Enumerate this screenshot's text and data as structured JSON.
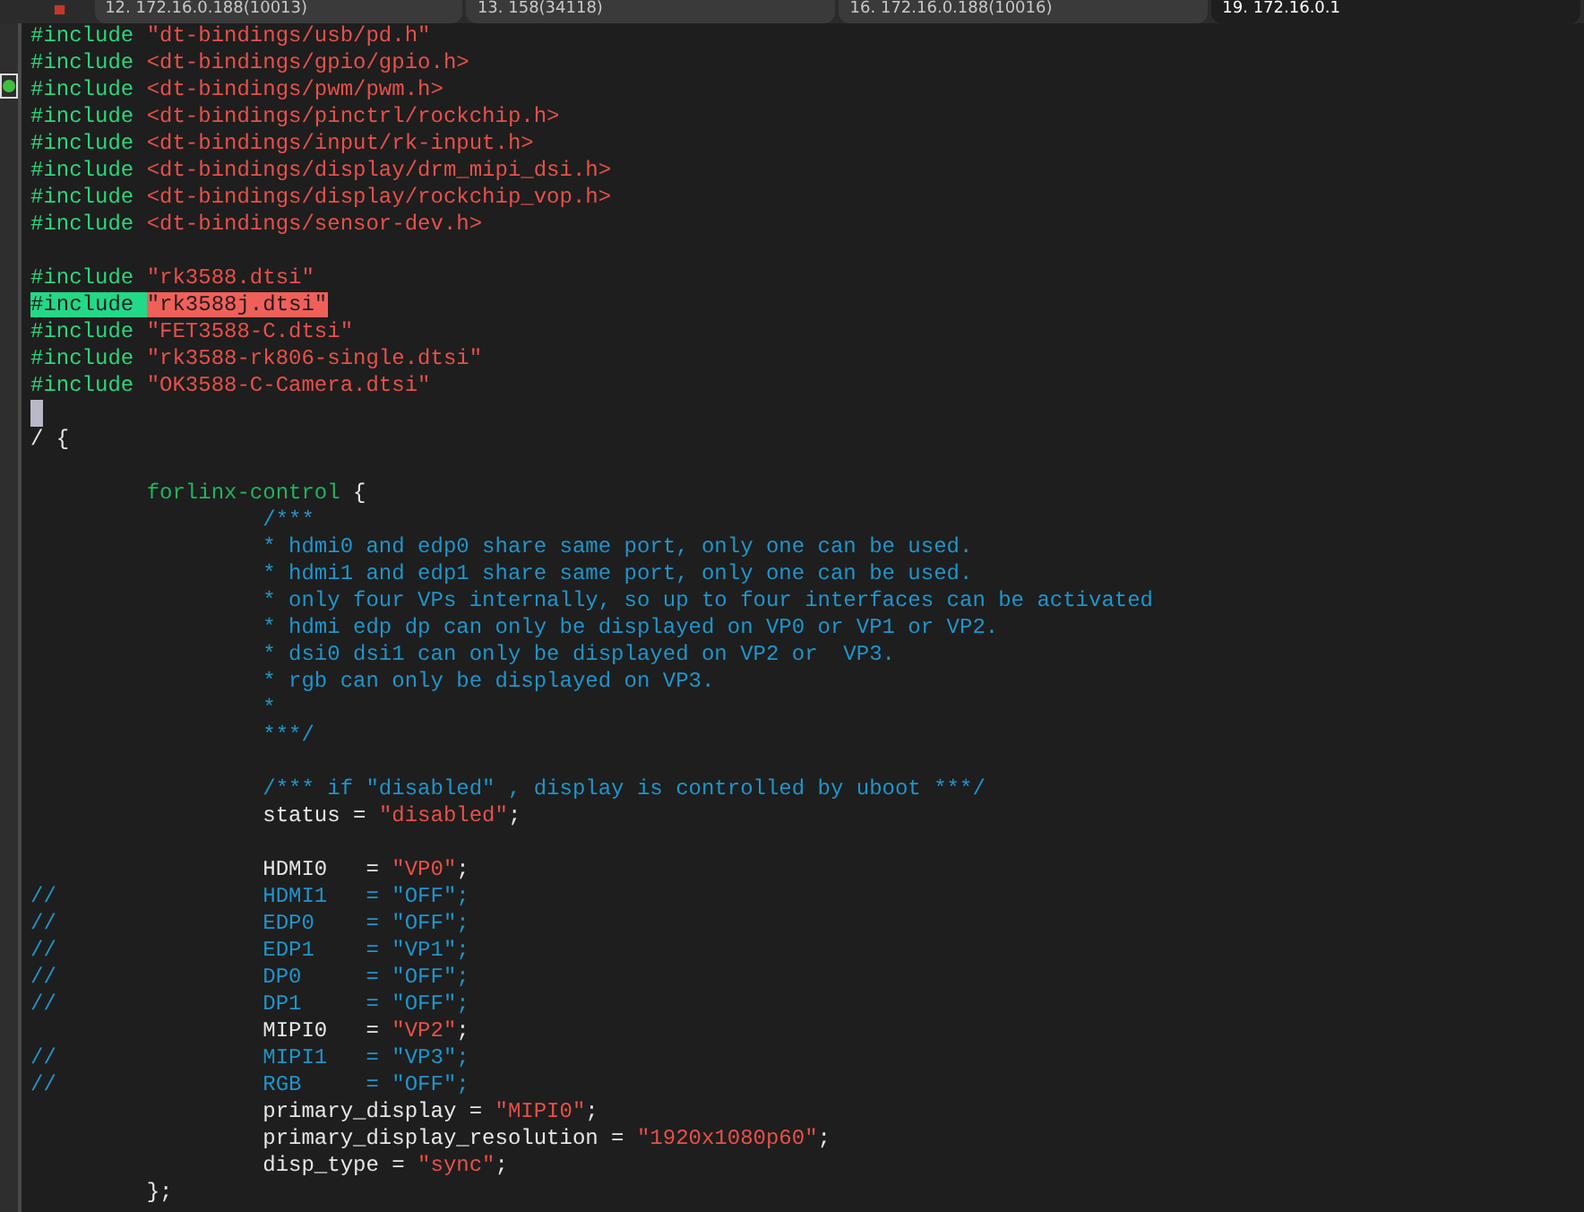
{
  "tabs": [
    {
      "label": "12. 172.16.0.188(10013)",
      "selected": false
    },
    {
      "label": "13. 158(34118)",
      "selected": false
    },
    {
      "label": "16. 172.16.0.188(10016)",
      "selected": false
    },
    {
      "label": "19. 172.16.0.1",
      "selected": true
    }
  ],
  "editor": {
    "lines": [
      {
        "kind": "code",
        "segments": [
          {
            "kind": "preproc",
            "text": "#include "
          },
          {
            "kind": "string",
            "text": "\"dt-bindings/usb/pd.h\""
          }
        ]
      },
      {
        "kind": "code",
        "segments": [
          {
            "kind": "preproc",
            "text": "#include "
          },
          {
            "kind": "string",
            "text": "<dt-bindings/gpio/gpio.h>"
          }
        ]
      },
      {
        "kind": "code",
        "segments": [
          {
            "kind": "preproc",
            "text": "#include "
          },
          {
            "kind": "string",
            "text": "<dt-bindings/pwm/pwm.h>"
          }
        ]
      },
      {
        "kind": "code",
        "segments": [
          {
            "kind": "preproc",
            "text": "#include "
          },
          {
            "kind": "string",
            "text": "<dt-bindings/pinctrl/rockchip.h>"
          }
        ]
      },
      {
        "kind": "code",
        "segments": [
          {
            "kind": "preproc",
            "text": "#include "
          },
          {
            "kind": "string",
            "text": "<dt-bindings/input/rk-input.h>"
          }
        ]
      },
      {
        "kind": "code",
        "segments": [
          {
            "kind": "preproc",
            "text": "#include "
          },
          {
            "kind": "string",
            "text": "<dt-bindings/display/drm_mipi_dsi.h>"
          }
        ]
      },
      {
        "kind": "code",
        "segments": [
          {
            "kind": "preproc",
            "text": "#include "
          },
          {
            "kind": "string",
            "text": "<dt-bindings/display/rockchip_vop.h>"
          }
        ]
      },
      {
        "kind": "code",
        "segments": [
          {
            "kind": "preproc",
            "text": "#include "
          },
          {
            "kind": "string",
            "text": "<dt-bindings/sensor-dev.h>"
          }
        ]
      },
      {
        "kind": "blank"
      },
      {
        "kind": "code",
        "segments": [
          {
            "kind": "preproc",
            "text": "#include "
          },
          {
            "kind": "string",
            "text": "\"rk3588.dtsi\""
          }
        ]
      },
      {
        "kind": "code",
        "highlighted": true,
        "segments": [
          {
            "kind": "preproc",
            "text": "#include "
          },
          {
            "kind": "string",
            "text": "\"rk3588j.dtsi\""
          }
        ]
      },
      {
        "kind": "code",
        "segments": [
          {
            "kind": "preproc",
            "text": "#include "
          },
          {
            "kind": "string",
            "text": "\"FET3588-C.dtsi\""
          }
        ]
      },
      {
        "kind": "code",
        "segments": [
          {
            "kind": "preproc",
            "text": "#include "
          },
          {
            "kind": "string",
            "text": "\"rk3588-rk806-single.dtsi\""
          }
        ]
      },
      {
        "kind": "code",
        "segments": [
          {
            "kind": "preproc",
            "text": "#include "
          },
          {
            "kind": "string",
            "text": "\"OK3588-C-Camera.dtsi\""
          }
        ]
      },
      {
        "kind": "blank",
        "cursor": true
      },
      {
        "kind": "code",
        "segments": [
          {
            "kind": "plain",
            "text": "/ {"
          }
        ]
      },
      {
        "kind": "blank"
      },
      {
        "kind": "code",
        "segments": [
          {
            "kind": "node",
            "text": "         forlinx-control"
          },
          {
            "kind": "plain",
            "text": " {"
          }
        ]
      },
      {
        "kind": "code",
        "segments": [
          {
            "kind": "comment",
            "text": "                  /***"
          }
        ]
      },
      {
        "kind": "code",
        "segments": [
          {
            "kind": "comment",
            "text": "                  * hdmi0 and edp0 share same port, only one can be used."
          }
        ]
      },
      {
        "kind": "code",
        "segments": [
          {
            "kind": "comment",
            "text": "                  * hdmi1 and edp1 share same port, only one can be used."
          }
        ]
      },
      {
        "kind": "code",
        "segments": [
          {
            "kind": "comment",
            "text": "                  * only four VPs internally, so up to four interfaces can be activated"
          }
        ]
      },
      {
        "kind": "code",
        "segments": [
          {
            "kind": "comment",
            "text": "                  * hdmi edp dp can only be displayed on VP0 or VP1 or VP2."
          }
        ]
      },
      {
        "kind": "code",
        "segments": [
          {
            "kind": "comment",
            "text": "                  * dsi0 dsi1 can only be displayed on VP2 or  VP3."
          }
        ]
      },
      {
        "kind": "code",
        "segments": [
          {
            "kind": "comment",
            "text": "                  * rgb can only be displayed on VP3."
          }
        ]
      },
      {
        "kind": "code",
        "segments": [
          {
            "kind": "comment",
            "text": "                  *"
          }
        ]
      },
      {
        "kind": "code",
        "segments": [
          {
            "kind": "comment",
            "text": "                  ***/"
          }
        ]
      },
      {
        "kind": "blank"
      },
      {
        "kind": "code",
        "segments": [
          {
            "kind": "comment",
            "text": "                  /*** if \"disabled\" , display is controlled by uboot ***/"
          }
        ]
      },
      {
        "kind": "code",
        "segments": [
          {
            "kind": "plain",
            "text": "                  status = "
          },
          {
            "kind": "string",
            "text": "\"disabled\""
          },
          {
            "kind": "plain",
            "text": ";"
          }
        ]
      },
      {
        "kind": "blank"
      },
      {
        "kind": "code",
        "segments": [
          {
            "kind": "plain",
            "text": "                  HDMI0   = "
          },
          {
            "kind": "string",
            "text": "\"VP0\""
          },
          {
            "kind": "plain",
            "text": ";"
          }
        ]
      },
      {
        "kind": "code",
        "segments": [
          {
            "kind": "comment",
            "text": "//                HDMI1   = \"OFF\";"
          }
        ]
      },
      {
        "kind": "code",
        "segments": [
          {
            "kind": "comment",
            "text": "//                EDP0    = \"OFF\";"
          }
        ]
      },
      {
        "kind": "code",
        "segments": [
          {
            "kind": "comment",
            "text": "//                EDP1    = \"VP1\";"
          }
        ]
      },
      {
        "kind": "code",
        "segments": [
          {
            "kind": "comment",
            "text": "//                DP0     = \"OFF\";"
          }
        ]
      },
      {
        "kind": "code",
        "segments": [
          {
            "kind": "comment",
            "text": "//                DP1     = \"OFF\";"
          }
        ]
      },
      {
        "kind": "code",
        "segments": [
          {
            "kind": "plain",
            "text": "                  MIPI0   = "
          },
          {
            "kind": "string",
            "text": "\"VP2\""
          },
          {
            "kind": "plain",
            "text": ";"
          }
        ]
      },
      {
        "kind": "code",
        "segments": [
          {
            "kind": "comment",
            "text": "//                MIPI1   = \"VP3\";"
          }
        ]
      },
      {
        "kind": "code",
        "segments": [
          {
            "kind": "comment",
            "text": "//                RGB     = \"OFF\";"
          }
        ]
      },
      {
        "kind": "code",
        "segments": [
          {
            "kind": "plain",
            "text": "                  primary_display = "
          },
          {
            "kind": "string",
            "text": "\"MIPI0\""
          },
          {
            "kind": "plain",
            "text": ";"
          }
        ]
      },
      {
        "kind": "code",
        "segments": [
          {
            "kind": "plain",
            "text": "                  primary_display_resolution = "
          },
          {
            "kind": "string",
            "text": "\"1920x1080p60\""
          },
          {
            "kind": "plain",
            "text": ";"
          }
        ]
      },
      {
        "kind": "code",
        "segments": [
          {
            "kind": "plain",
            "text": "                  disp_type = "
          },
          {
            "kind": "string",
            "text": "\"sync\""
          },
          {
            "kind": "plain",
            "text": ";"
          }
        ]
      },
      {
        "kind": "code",
        "segments": [
          {
            "kind": "plain",
            "text": "         };"
          }
        ]
      }
    ]
  }
}
